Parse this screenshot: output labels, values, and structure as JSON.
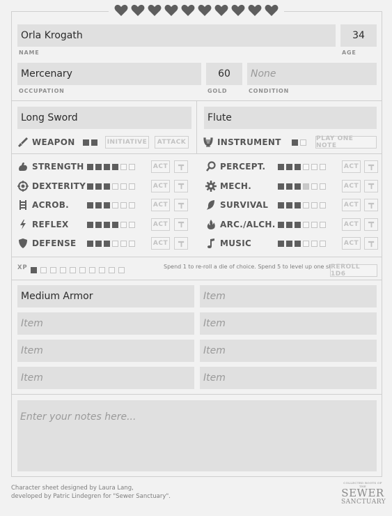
{
  "hearts": {
    "count": 10
  },
  "character": {
    "name": "Orla Krogath",
    "name_label": "NAME",
    "age": "34",
    "age_label": "AGE",
    "occupation": "Mercenary",
    "occupation_label": "OCCUPATION",
    "gold": "60",
    "gold_label": "GOLD",
    "condition": "None",
    "condition_label": "CONDITION"
  },
  "weapon": {
    "value": "Long Sword",
    "label": "WEAPON",
    "pips_total": 2,
    "pips_filled": 2,
    "initiative_label": "INITIATIVE",
    "attack_label": "ATTACK"
  },
  "instrument": {
    "value": "Flute",
    "label": "INSTRUMENT",
    "pips_total": 2,
    "pips_filled": 1,
    "play_label": "PLAY ONE NOTE"
  },
  "act_label": "ACT",
  "skills_left": [
    {
      "name": "STRENGTH",
      "icon": "flexed-arm-icon",
      "filled": 4,
      "total": 6
    },
    {
      "name": "DEXTERITY",
      "icon": "target-icon",
      "filled": 3,
      "total": 6
    },
    {
      "name": "ACROB.",
      "icon": "ladder-icon",
      "filled": 3,
      "total": 6
    },
    {
      "name": "REFLEX",
      "icon": "lightning-icon",
      "filled": 4,
      "total": 6
    },
    {
      "name": "DEFENSE",
      "icon": "shield-icon",
      "filled": 3,
      "total": 6
    }
  ],
  "skills_right": [
    {
      "name": "PERCEPT.",
      "icon": "magnifier-icon",
      "filled": 3,
      "total": 6
    },
    {
      "name": "MECH.",
      "icon": "gear-icon",
      "filled": 3,
      "half": 1,
      "total": 6
    },
    {
      "name": "SURVIVAL",
      "icon": "leaf-icon",
      "filled": 3,
      "total": 6
    },
    {
      "name": "ARC./ALCH.",
      "icon": "flame-icon",
      "filled": 3,
      "total": 6
    },
    {
      "name": "MUSIC",
      "icon": "music-note-icon",
      "filled": 3,
      "total": 6
    }
  ],
  "xp": {
    "label": "XP",
    "filled": 1,
    "total": 10,
    "note": "Spend 1 to re-roll a die of choice. Spend 5 to level up one skill.",
    "reroll_label": "REROLL 1D6"
  },
  "inventory": [
    {
      "value": "Medium Armor",
      "placeholder": "Item"
    },
    {
      "value": "",
      "placeholder": "Item"
    },
    {
      "value": "",
      "placeholder": "Item"
    },
    {
      "value": "",
      "placeholder": "Item"
    },
    {
      "value": "",
      "placeholder": "Item"
    },
    {
      "value": "",
      "placeholder": "Item"
    },
    {
      "value": "",
      "placeholder": "Item"
    },
    {
      "value": "",
      "placeholder": "Item"
    }
  ],
  "notes": {
    "placeholder": "Enter your notes here..."
  },
  "footer": {
    "line1": "Character sheet designed by Laura Lang,",
    "line2": "developed by Patric Lindegren for \"Sewer Sanctuary\"."
  },
  "logo": {
    "top": "COLLECTED ROOTS OF THE",
    "line1": "SEWER",
    "line2": "SANCTUARY"
  },
  "colors": {
    "background": "#f2f2f2",
    "field": "#e0e0e0",
    "pip_filled": "#5e5e5e",
    "border": "#cfcfcf"
  }
}
